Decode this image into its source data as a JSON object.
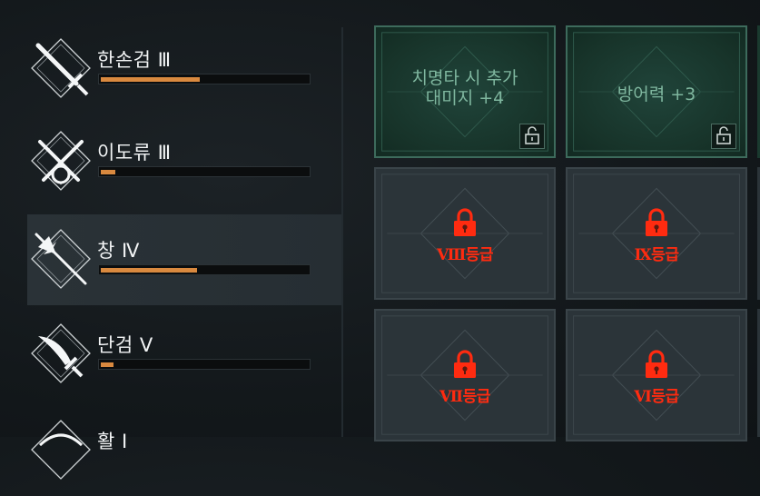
{
  "weapons": [
    {
      "name": "한손검 Ⅲ",
      "progress": 0.47,
      "selected": false,
      "icon": "one-hand-sword-icon"
    },
    {
      "name": "이도류 Ⅲ",
      "progress": 0.07,
      "selected": false,
      "icon": "dual-blades-icon"
    },
    {
      "name": "창 Ⅳ",
      "progress": 0.46,
      "selected": true,
      "icon": "spear-icon"
    },
    {
      "name": "단검 Ⅴ",
      "progress": 0.06,
      "selected": false,
      "icon": "dagger-icon"
    },
    {
      "name": "활 Ⅰ",
      "progress": 0.0,
      "selected": false,
      "icon": "bow-icon"
    }
  ],
  "cards": [
    {
      "type": "unlocked",
      "text_line1": "치명타 시 추가",
      "text_line2": "대미지 +4",
      "icon": "unlock-icon"
    },
    {
      "type": "unlocked",
      "text_line1": "방어력 +3",
      "text_line2": "",
      "icon": "unlock-icon"
    },
    {
      "type": "locked",
      "grade": "Ⅷ등급",
      "icon": "lock-icon"
    },
    {
      "type": "locked",
      "grade": "Ⅸ등급",
      "icon": "lock-icon"
    },
    {
      "type": "locked",
      "grade": "Ⅶ등급",
      "icon": "lock-icon"
    },
    {
      "type": "locked",
      "grade": "Ⅵ등급",
      "icon": "lock-icon"
    }
  ],
  "colors": {
    "progress": "#d9893f",
    "unlocked_text": "#7fb79f",
    "locked_grade": "#ff2b10"
  }
}
